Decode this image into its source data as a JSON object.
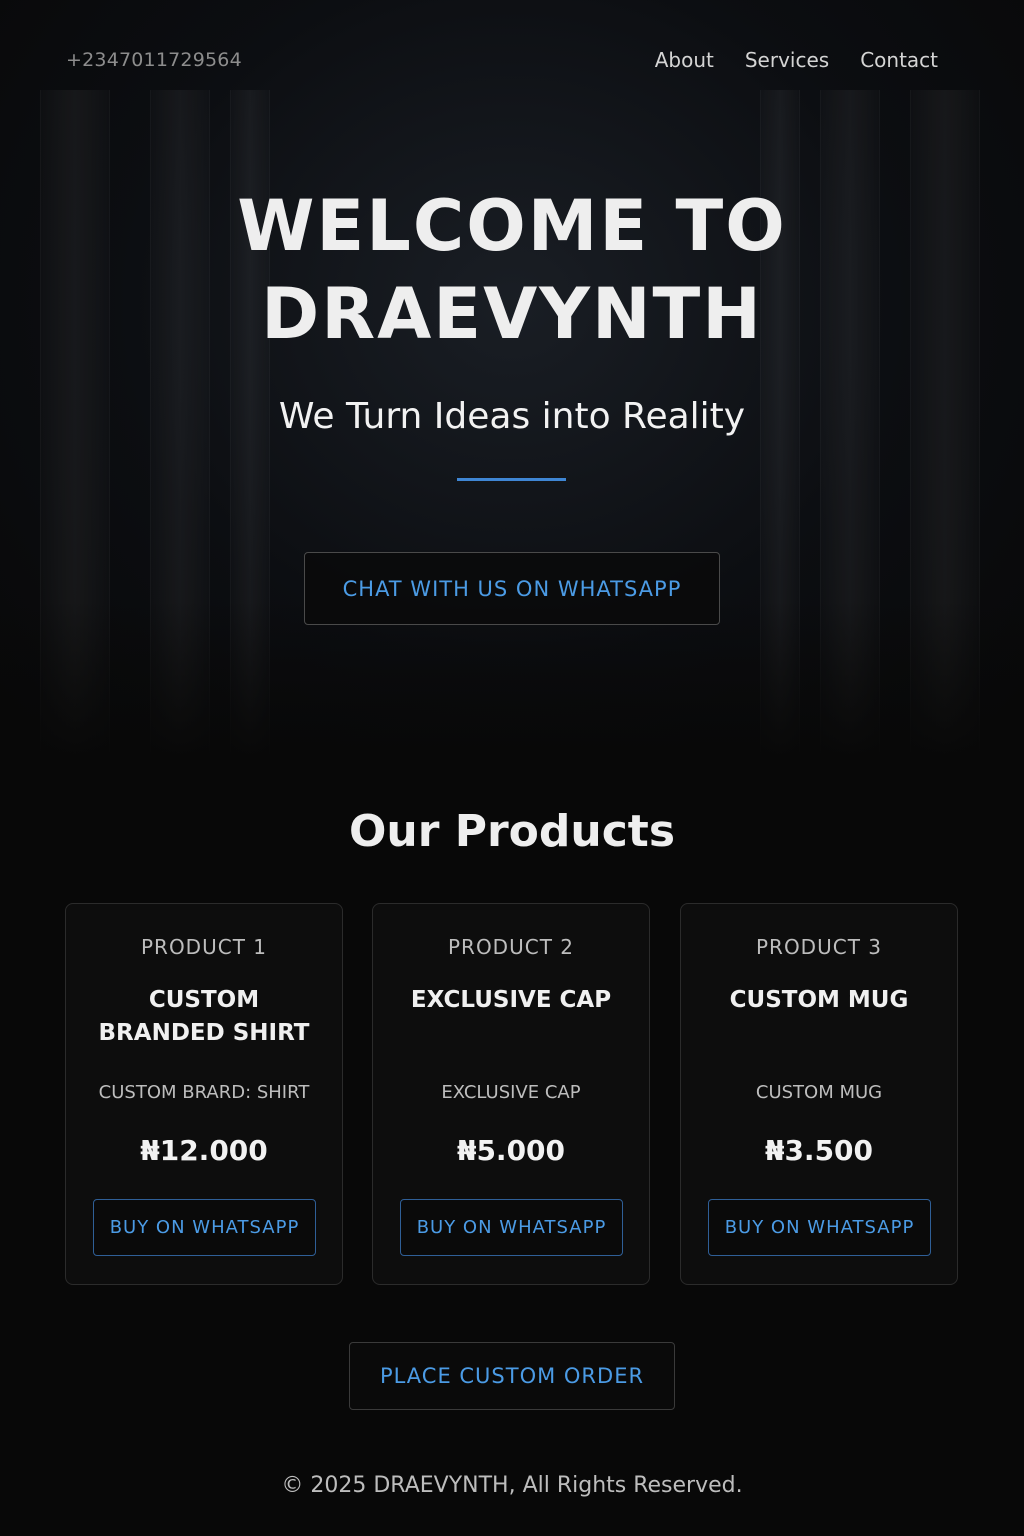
{
  "header": {
    "phone": "+2347011729564",
    "nav": [
      "About",
      "Services",
      "Contact"
    ]
  },
  "hero": {
    "title_line1": "WELCOME TO",
    "title_line2": "DRAEVYNTH",
    "subtitle": "We Turn Ideas into Reality",
    "cta_label": "CHAT WITH US ON WHATSAPP"
  },
  "products": {
    "title": "Our Products",
    "items": [
      {
        "number": "PRODUCT 1",
        "name": "CUSTOM BRANDED SHIRT",
        "desc": "CUSTOM BRARD: SHIRT",
        "price": "₦12.000",
        "button": "BUY ON WHATSAPP"
      },
      {
        "number": "PRODUCT 2",
        "name": "EXCLUSIVE CAP",
        "desc": "EXCLUSIVE CAP",
        "price": "₦5.000",
        "button": "BUY ON WHATSAPP"
      },
      {
        "number": "PRODUCT 3",
        "name": "CUSTOM MUG",
        "desc": "CUSTOM MUG",
        "price": "₦3.500",
        "button": "BUY ON WHATSAPP"
      }
    ],
    "custom_order_label": "PLACE CUSTOM ORDER"
  },
  "footer": {
    "copyright": "© 2025 DRAEVYNTH, All Rights Reserved."
  },
  "colors": {
    "accent": "#4b9be5",
    "background": "#080808"
  }
}
